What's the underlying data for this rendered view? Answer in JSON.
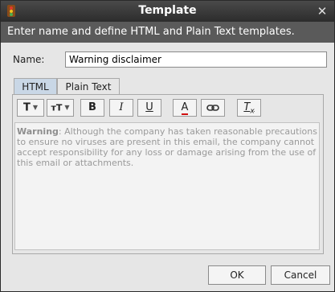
{
  "window": {
    "title": "Template"
  },
  "banner": {
    "text": "Enter name and define HTML and Plain Text templates."
  },
  "form": {
    "name_label": "Name:",
    "name_value": "Warning disclaimer"
  },
  "tabs": [
    {
      "label": "HTML",
      "selected": true
    },
    {
      "label": "Plain Text",
      "selected": false
    }
  ],
  "toolbar": {
    "buttons": [
      {
        "name": "font-family-icon",
        "glyph": "T"
      },
      {
        "name": "font-size-icon",
        "glyph": "ᴛT"
      },
      {
        "name": "bold-icon",
        "glyph": "B"
      },
      {
        "name": "italic-icon",
        "glyph": "I"
      },
      {
        "name": "underline-icon",
        "glyph": "U"
      },
      {
        "name": "font-color-icon",
        "glyph": "A"
      },
      {
        "name": "link-icon",
        "glyph": "⊖"
      },
      {
        "name": "clear-format-icon",
        "glyph": "Tx"
      }
    ]
  },
  "editor": {
    "bold_prefix": "Warning",
    "body": ": Although the company has taken reasonable precautions to ensure no viruses are present in this email, the company cannot accept responsibility for any loss or damage arising from the use of this email or attachments."
  },
  "buttons": {
    "ok": "OK",
    "cancel": "Cancel"
  },
  "colors": {
    "titlebar": "#2c2c2c",
    "banner": "#5a5a5a",
    "selected_tab": "#c9d7e6",
    "font_color_underline": "#d01010"
  }
}
